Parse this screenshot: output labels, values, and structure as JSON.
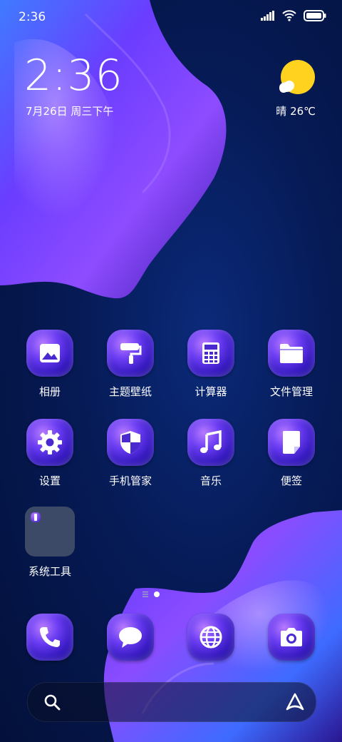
{
  "status_bar": {
    "time": "2:36"
  },
  "clock_widget": {
    "time": "2:36",
    "date": "7月26日 周三下午"
  },
  "weather": {
    "text": "晴 26℃"
  },
  "apps_row1": [
    {
      "label": "相册",
      "icon": "gallery-icon"
    },
    {
      "label": "主题壁纸",
      "icon": "paint-roller-icon"
    },
    {
      "label": "计算器",
      "icon": "calculator-icon"
    },
    {
      "label": "文件管理",
      "icon": "folder-icon"
    }
  ],
  "apps_row2": [
    {
      "label": "设置",
      "icon": "gear-icon"
    },
    {
      "label": "手机管家",
      "icon": "shield-icon"
    },
    {
      "label": "音乐",
      "icon": "music-note-icon"
    },
    {
      "label": "便签",
      "icon": "note-icon"
    }
  ],
  "folder": {
    "label": "系统工具"
  },
  "dock": [
    {
      "icon": "phone-icon"
    },
    {
      "icon": "message-icon"
    },
    {
      "icon": "browser-globe-icon"
    },
    {
      "icon": "camera-icon"
    }
  ],
  "colors": {
    "accent": "#6a3cf2",
    "weather_sun": "#ffd21f"
  }
}
